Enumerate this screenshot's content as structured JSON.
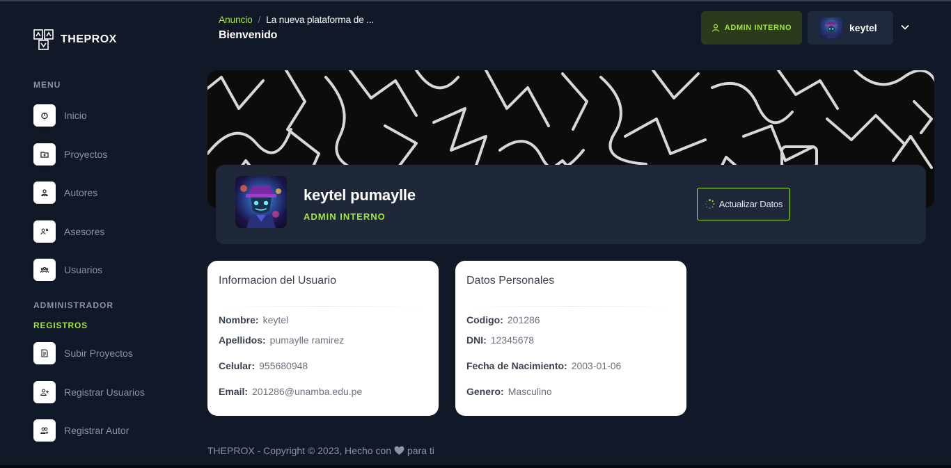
{
  "app": {
    "name": "THEPROX"
  },
  "sidebar": {
    "menu_title": "MENU",
    "menu_items": [
      {
        "label": "Inicio",
        "icon": "home-icon"
      },
      {
        "label": "Proyectos",
        "icon": "folder-icon"
      },
      {
        "label": "Autores",
        "icon": "user-icon"
      },
      {
        "label": "Asesores",
        "icon": "advisor-icon"
      },
      {
        "label": "Usuarios",
        "icon": "users-icon"
      }
    ],
    "admin_title": "ADMINISTRADOR",
    "registros_title": "REGISTROS",
    "admin_items": [
      {
        "label": "Subir Proyectos",
        "icon": "upload-document-icon"
      },
      {
        "label": "Registrar Usuarios",
        "icon": "user-plus-icon"
      },
      {
        "label": "Registrar Autor",
        "icon": "user-group-add-icon"
      }
    ]
  },
  "header": {
    "breadcrumb": {
      "link": "Anuncio",
      "separator": "/",
      "current": "La nueva plataforma de ..."
    },
    "page_title": "Bienvenido",
    "role_button": "ADMIN INTERNO",
    "user_name": "keytel"
  },
  "profile": {
    "full_name": "keytel pumaylle",
    "role": "ADMIN INTERNO",
    "update_button": "Actualizar Datos"
  },
  "user_info": {
    "title": "Informacion del Usuario",
    "fields": [
      {
        "label": "Nombre:",
        "value": "keytel"
      },
      {
        "label": "Apellidos:",
        "value": "pumaylle ramirez"
      },
      {
        "label": "Celular:",
        "value": "955680948"
      },
      {
        "label": "Email:",
        "value": "201286@unamba.edu.pe"
      }
    ]
  },
  "personal_data": {
    "title": "Datos Personales",
    "fields": [
      {
        "label": "Codigo:",
        "value": "201286"
      },
      {
        "label": "DNI:",
        "value": "12345678"
      },
      {
        "label": "Fecha de Nacimiento:",
        "value": "2003-01-06"
      },
      {
        "label": "Genero:",
        "value": "Masculino"
      }
    ]
  },
  "footer": {
    "before": "THEPROX - Copyright © 2023, Hecho con",
    "after": "para ti"
  },
  "colors": {
    "background": "#111827",
    "accent": "#a3e635",
    "card": "#1e2838",
    "muted_text": "#8b94a3"
  }
}
